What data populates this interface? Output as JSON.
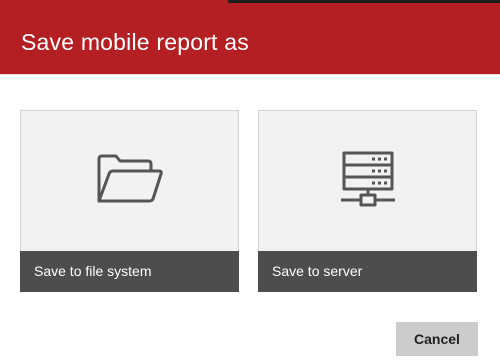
{
  "dialog": {
    "title": "Save mobile report as",
    "accent_color": "#b41f23"
  },
  "options": [
    {
      "label": "Save to file system",
      "icon": "folder-icon"
    },
    {
      "label": "Save to server",
      "icon": "server-icon"
    }
  ],
  "buttons": {
    "cancel_label": "Cancel"
  }
}
